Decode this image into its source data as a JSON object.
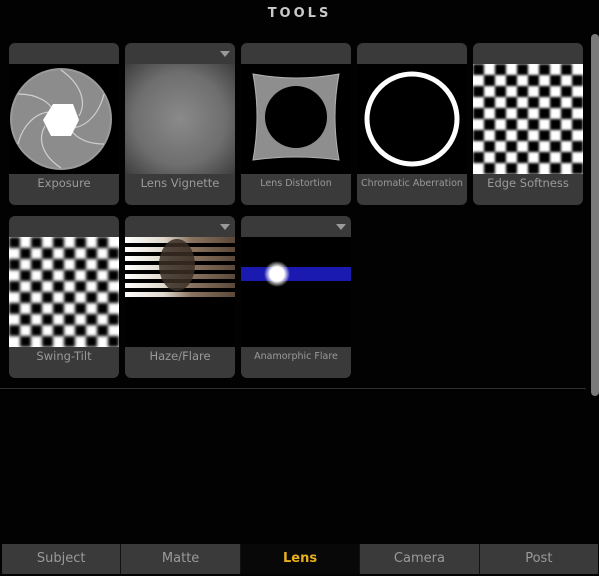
{
  "header": {
    "title": "TOOLS"
  },
  "tools": [
    {
      "label": "Exposure",
      "icon": "aperture-icon",
      "has_menu": false
    },
    {
      "label": "Lens Vignette",
      "icon": "vignette-icon",
      "has_menu": true
    },
    {
      "label": "Lens Distortion",
      "icon": "distortion-icon",
      "has_menu": false
    },
    {
      "label": "Chromatic Aberration",
      "icon": "ring-icon",
      "has_menu": false
    },
    {
      "label": "Edge Softness",
      "icon": "checker-soft-icon",
      "has_menu": false
    },
    {
      "label": "Swing-Tilt",
      "icon": "checker-tilt-icon",
      "has_menu": false
    },
    {
      "label": "Haze/Flare",
      "icon": "haze-icon",
      "has_menu": true
    },
    {
      "label": "Anamorphic Flare",
      "icon": "anamorphic-flare-icon",
      "has_menu": true
    }
  ],
  "tabs": [
    {
      "label": "Subject",
      "active": false
    },
    {
      "label": "Matte",
      "active": false
    },
    {
      "label": "Lens",
      "active": true
    },
    {
      "label": "Camera",
      "active": false
    },
    {
      "label": "Post",
      "active": false
    }
  ],
  "colors": {
    "active_tab": "#e8b020",
    "tile": "#3a3a3a",
    "background": "#020202"
  }
}
